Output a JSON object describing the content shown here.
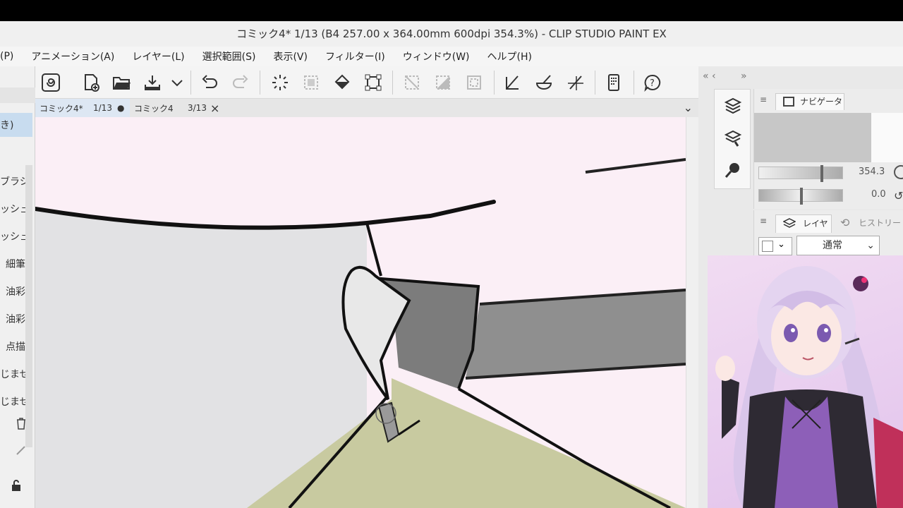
{
  "window": {
    "title": "コミック4* 1/13 (B4 257.00 x 364.00mm 600dpi 354.3%)  - CLIP STUDIO PAINT EX"
  },
  "menu": {
    "items": [
      "(P)",
      "アニメーション(A)",
      "レイヤー(L)",
      "選択範囲(S)",
      "表示(V)",
      "フィルター(I)",
      "ウィンドウ(W)",
      "ヘルプ(H)"
    ]
  },
  "toolbar": {
    "buttons": [
      "clip-studio-icon",
      "new-canvas-icon",
      "open-icon",
      "save-icon",
      "dropdown-icon",
      "undo-icon",
      "redo-icon",
      "loading-icon",
      "select-icon",
      "fill-icon",
      "transform-icon",
      "deselect-icon",
      "invert-icon",
      "border-icon",
      "pen-tool-icon",
      "brush-tool-icon",
      "ruler-tool-icon",
      "device-icon",
      "help-icon"
    ]
  },
  "tabs": [
    {
      "name": "コミック4*",
      "page": "1/13",
      "state": "●"
    },
    {
      "name": "コミック4",
      "page": "3/13",
      "state": "×"
    }
  ],
  "left_panel": {
    "items": [
      "き)",
      "ブラシ",
      "ッシュ",
      "ッシュ",
      "細筆",
      "油彩",
      "油彩",
      "点描",
      "じませ",
      "じませ"
    ]
  },
  "navigator": {
    "tab_label": "ナビゲーター",
    "zoom_value": "354.3",
    "rotate_value": "0.0",
    "zoom_fraction": 0.75,
    "rotate_fraction": 0.5
  },
  "layer_panel": {
    "tab_layer": "レイヤー",
    "tab_history": "ヒストリー",
    "blend_mode": "通常"
  },
  "colors": {
    "canvas_bg": "#fbeff6",
    "accent_tab": "#dde7f3",
    "selected_item": "#c8dcef"
  }
}
